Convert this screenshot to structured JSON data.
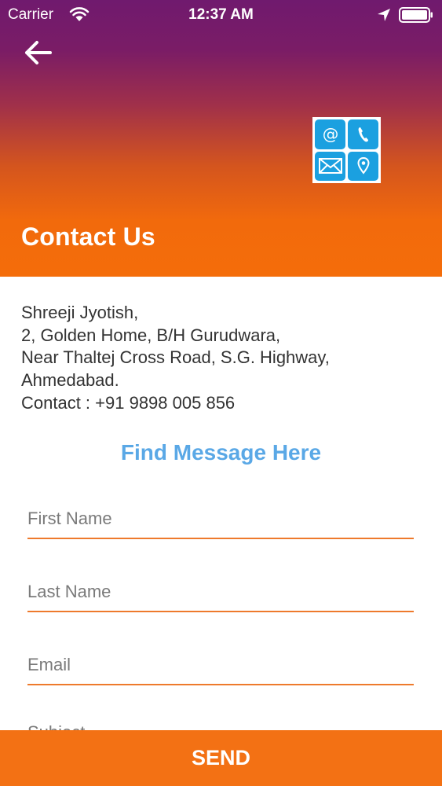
{
  "status_bar": {
    "carrier": "Carrier",
    "time": "12:37 AM",
    "icons": [
      "wifi-icon",
      "location-arrow-icon",
      "battery-icon"
    ]
  },
  "header": {
    "back_icon": "back-arrow-icon",
    "logo_icons": [
      "at-sign-icon",
      "phone-icon",
      "envelope-icon",
      "map-pin-icon"
    ],
    "title": "Contact Us",
    "gradient_top": "#701a6e",
    "gradient_bottom": "#f46d0a"
  },
  "address": {
    "lines": [
      "Shreeji Jyotish,",
      "2, Golden Home, B/H Gurudwara,",
      "Near Thaltej Cross Road, S.G. Highway,",
      "Ahmedabad.",
      "Contact : +91 9898 005 856"
    ]
  },
  "form": {
    "heading": "Find Message Here",
    "fields": [
      {
        "placeholder": "First Name",
        "value": ""
      },
      {
        "placeholder": "Last Name",
        "value": ""
      },
      {
        "placeholder": "Email",
        "value": ""
      },
      {
        "placeholder": "Subject",
        "value": ""
      }
    ],
    "accent_color": "#ee7a2c",
    "heading_color": "#5aa8e6"
  },
  "footer": {
    "send_label": "SEND",
    "button_color": "#f37114"
  }
}
